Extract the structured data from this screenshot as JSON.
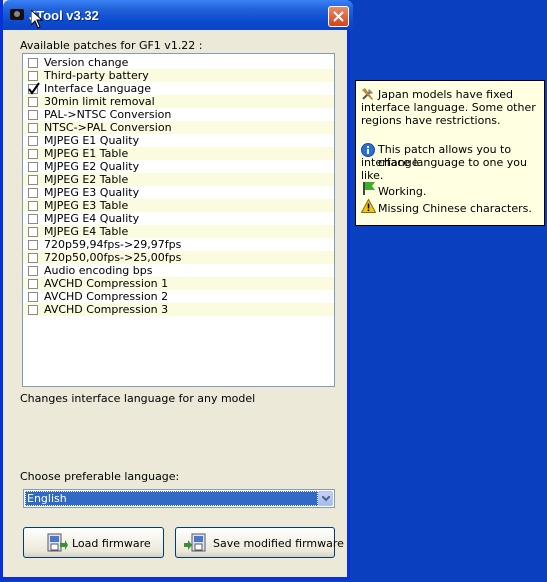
{
  "window": {
    "title": "JTool v3.32"
  },
  "patches_header": "Available patches for GF1 v1.22 :",
  "patches": [
    {
      "label": "Version change",
      "checked": false
    },
    {
      "label": "Third-party battery",
      "checked": false
    },
    {
      "label": "Interface Language",
      "checked": true
    },
    {
      "label": "30min limit removal",
      "checked": false
    },
    {
      "label": "PAL->NTSC Conversion",
      "checked": false
    },
    {
      "label": "NTSC->PAL Conversion",
      "checked": false
    },
    {
      "label": "MJPEG E1 Quality",
      "checked": false
    },
    {
      "label": "MJPEG E1 Table",
      "checked": false
    },
    {
      "label": "MJPEG E2 Quality",
      "checked": false
    },
    {
      "label": "MJPEG E2 Table",
      "checked": false
    },
    {
      "label": "MJPEG E3 Quality",
      "checked": false
    },
    {
      "label": "MJPEG E3 Table",
      "checked": false
    },
    {
      "label": "MJPEG E4 Quality",
      "checked": false
    },
    {
      "label": "MJPEG E4 Table",
      "checked": false
    },
    {
      "label": "720p59,94fps->29,97fps",
      "checked": false
    },
    {
      "label": "720p50,00fps->25,00fps",
      "checked": false
    },
    {
      "label": "Audio encoding bps",
      "checked": false
    },
    {
      "label": "AVCHD Compression 1",
      "checked": false
    },
    {
      "label": "AVCHD Compression 2",
      "checked": false
    },
    {
      "label": "AVCHD Compression 3",
      "checked": false
    }
  ],
  "description": "Changes interface language for any model",
  "language": {
    "label": "Choose preferable language:",
    "selected": "English"
  },
  "buttons": {
    "load": "Load firmware",
    "save": "Save modified firmware"
  },
  "tooltip": {
    "line1a": "Japan models have fixed",
    "line1b": "interface language. Some other",
    "line1c": "regions have restrictions.",
    "line2a": "This patch allows you to change",
    "line2b": "interface language to one you like.",
    "status_working": "Working.",
    "status_warning": "Missing Chinese characters."
  },
  "colors": {
    "desktop": "#0a3fbf",
    "selection": "#316ac5",
    "tooltip_bg": "#ffffe1"
  }
}
